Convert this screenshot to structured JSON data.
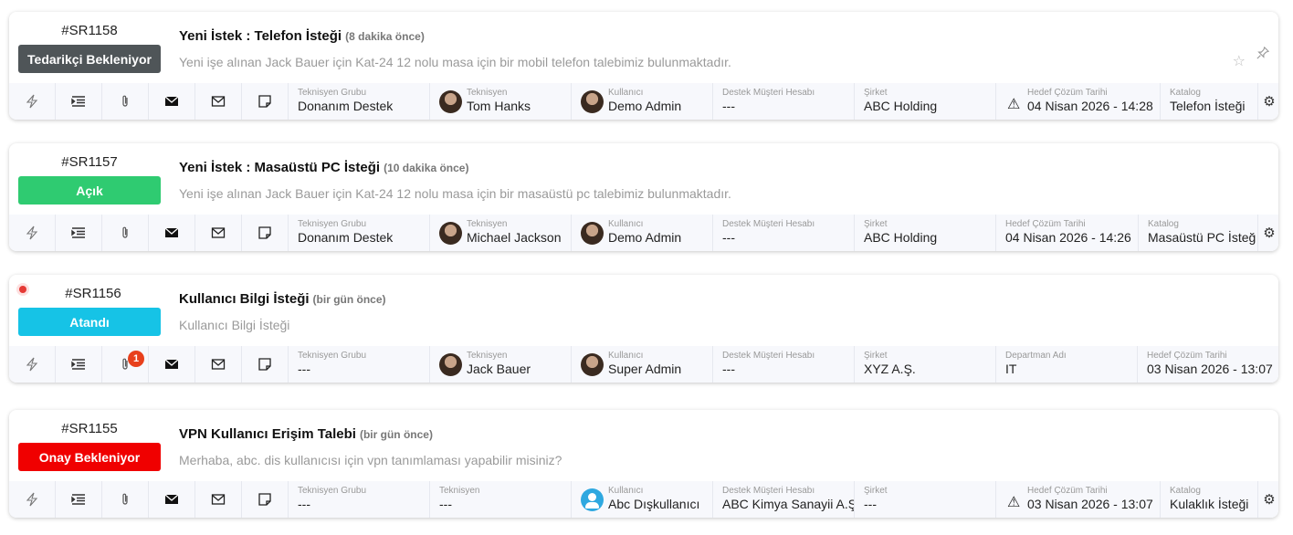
{
  "labels": {
    "tech_group": "Teknisyen Grubu",
    "technician": "Teknisyen",
    "user": "Kullanıcı",
    "support_account": "Destek Müşteri Hesabı",
    "company": "Şirket",
    "target_date": "Hedef Çözüm Tarihi",
    "catalog": "Katalog",
    "department": "Departman Adı"
  },
  "colors": {
    "waiting_supplier": "#4f5558",
    "open": "#2fcb71",
    "assigned": "#16c3e6",
    "waiting_approval": "#f00000"
  },
  "icons": [
    "bolt-icon",
    "list-indent-icon",
    "paperclip-icon",
    "envelope-filled-icon",
    "envelope-outline-icon",
    "note-icon"
  ],
  "requests": [
    {
      "id": "#SR1158",
      "status": "Tedarikçi Bekleniyor",
      "title": "Yeni İstek : Telefon İsteği",
      "ago": "(8 dakika önce)",
      "desc": "Yeni işe alınan Jack Bauer için Kat-24 12 nolu masa için bir mobil telefon talebimiz bulunmaktadır.",
      "tech_group": "Donanım Destek",
      "technician": "Tom Hanks",
      "user": "Demo Admin",
      "support_account": "---",
      "company": "ABC Holding",
      "target_date": "04 Nisan 2026 - 14:28",
      "catalog": "Telefon İsteği"
    },
    {
      "id": "#SR1157",
      "status": "Açık",
      "title": "Yeni İstek : Masaüstü PC İsteği",
      "ago": "(10 dakika önce)",
      "desc": "Yeni işe alınan Jack Bauer için Kat-24 12 nolu masa için bir masaüstü pc talebimiz bulunmaktadır.",
      "tech_group": "Donanım Destek",
      "technician": "Michael Jackson",
      "user": "Demo Admin",
      "support_account": "---",
      "company": "ABC Holding",
      "target_date": "04 Nisan 2026 - 14:26",
      "catalog": "Masaüstü PC İsteğ"
    },
    {
      "id": "#SR1156",
      "status": "Atandı",
      "title": "Kullanıcı Bilgi İsteği",
      "ago": "(bir gün önce)",
      "desc": "Kullanıcı Bilgi İsteği",
      "attachments": "1",
      "tech_group": "---",
      "technician": "Jack Bauer",
      "user": "Super Admin",
      "support_account": "---",
      "company": "XYZ A.Ş.",
      "department": "IT",
      "target_date": "03 Nisan 2026 - 13:07"
    },
    {
      "id": "#SR1155",
      "status": "Onay Bekleniyor",
      "title": "VPN Kullanıcı Erişim Talebi",
      "ago": "(bir gün önce)",
      "desc": "Merhaba, abc. dis kullanıcısı için vpn tanımlaması yapabilir misiniz?",
      "tech_group": "---",
      "technician": "---",
      "user": "Abc Dışkullanıcı",
      "support_account": "ABC Kimya Sanayii A.Ş",
      "company": "---",
      "target_date": "03 Nisan 2026 - 13:07",
      "catalog": "Kulaklık İsteği"
    }
  ]
}
